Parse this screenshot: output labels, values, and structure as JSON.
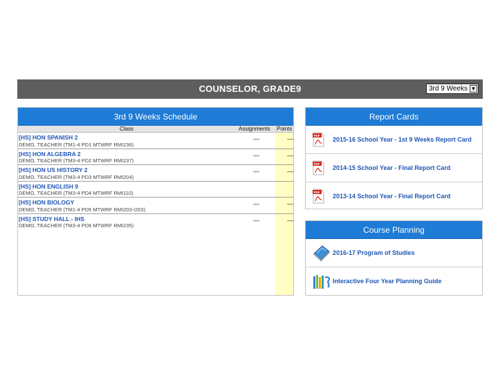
{
  "header": {
    "title": "COUNSELOR, GRADE9",
    "period_selected": "3rd 9 Weeks"
  },
  "schedule": {
    "title": "3rd 9 Weeks Schedule",
    "columns": {
      "class": "Class",
      "assignments": "Assignments",
      "points": "Points"
    },
    "rows": [
      {
        "name": "[HS] HON SPANISH 2",
        "detail": "DEMO, TEACHER (TM1-4 PD1 MTWRF RMI236)",
        "assignments": "—",
        "points": "—"
      },
      {
        "name": "[HS] HON ALGEBRA 2",
        "detail": "DEMO, TEACHER (TM3-4 PD2 MTWRF RMI237)",
        "assignments": "—",
        "points": "—"
      },
      {
        "name": "[HS] HON US HISTORY 2",
        "detail": "DEMO, TEACHER (TM3-4 PD3 MTWRF RMI204)",
        "assignments": "—",
        "points": "—"
      },
      {
        "name": "[HS] HON ENGLISH 9",
        "detail": "DEMO, TEACHER (TM3-4 PD4 MTWRF RMI110)",
        "assignments": "",
        "points": ""
      },
      {
        "name": "[HS] HON BIOLOGY",
        "detail": "DEMO, TEACHER (TM1-4 PD5 MTWRF RMI203-I203)",
        "assignments": "—",
        "points": "—"
      },
      {
        "name": "[HS] STUDY HALL - IHS",
        "detail": "DEMO, TEACHER (TM3-4 PD6 MTWRF RMI235)",
        "assignments": "—",
        "points": "—"
      }
    ]
  },
  "report_cards": {
    "title": "Report Cards",
    "items": [
      {
        "label": "2015-16 School Year - 1st 9 Weeks Report Card",
        "icon": "pdf-icon"
      },
      {
        "label": "2014-15 School Year - Final Report Card",
        "icon": "pdf-icon"
      },
      {
        "label": "2013-14 School Year - Final Report Card",
        "icon": "pdf-icon"
      }
    ]
  },
  "course_planning": {
    "title": "Course Planning",
    "items": [
      {
        "label": "2016-17 Program of Studies",
        "icon": "book-icon"
      },
      {
        "label": "Interactive Four Year Planning Guide",
        "icon": "books-logo-icon"
      }
    ]
  },
  "colors": {
    "panel_header": "#1e7bd6",
    "top_bar": "#5e5e5e",
    "link": "#1f56b5",
    "points_column": "#ffffc4",
    "pdf_red": "#d8241c"
  }
}
